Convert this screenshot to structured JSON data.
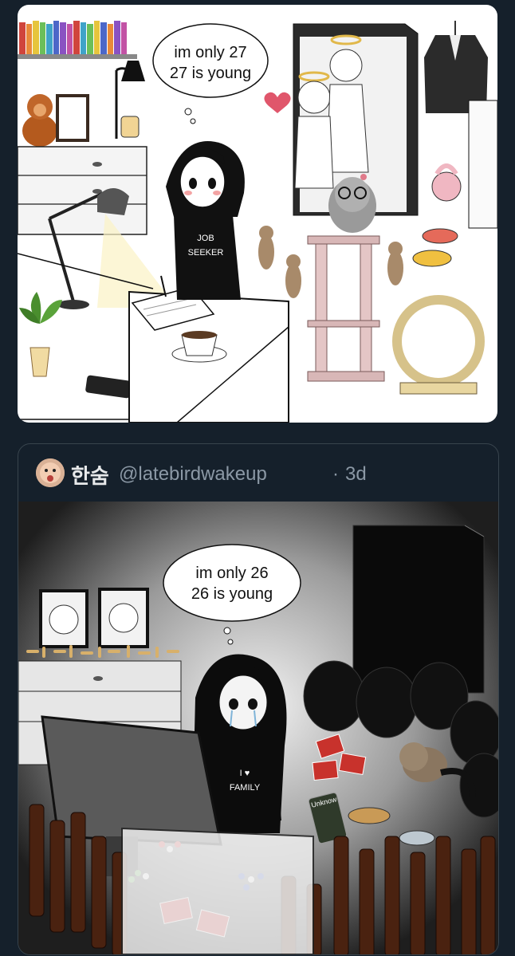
{
  "comic1": {
    "bubble_line1": "im only 27",
    "bubble_line2": "27 is young",
    "shirt_line1": "JOB",
    "shirt_line2": "SEEKER"
  },
  "quote_tweet": {
    "display_name": "한숨",
    "handle": "@latebirdwakeup",
    "separator": "·",
    "time": "3d"
  },
  "comic2": {
    "bubble_line1": "im only 26",
    "bubble_line2": "26 is young",
    "shirt_line1": "I ♥",
    "shirt_line2": "FAMILY",
    "label": "Unknow"
  },
  "colors": {
    "background": "#15202b",
    "card_border": "#38444d",
    "name": "#e7e9ea",
    "muted": "#8b98a5",
    "heart": "#e0566b"
  }
}
